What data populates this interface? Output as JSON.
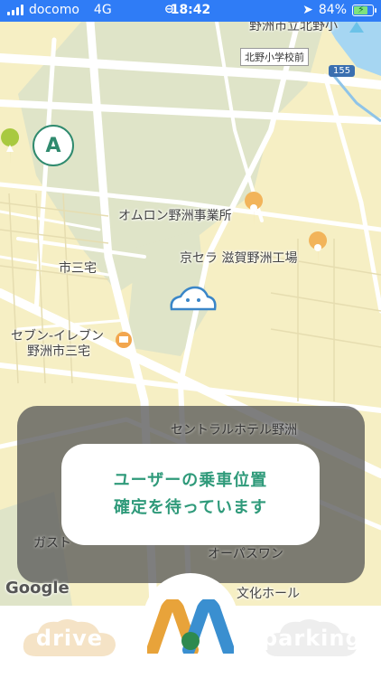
{
  "status": {
    "carrier": "docomo",
    "network": "4G",
    "time": "18:42",
    "battery": "84%"
  },
  "map": {
    "labels": {
      "school_top": "野洲市立北野小",
      "bus_stop": "北野小学校前",
      "route_number": "155",
      "omron": "オムロン野洲事業所",
      "kyocera": "京セラ 滋賀野洲工場",
      "ichimiyake": "市三宅",
      "seven_line1": "セブン-イレブン",
      "seven_line2": "野洲市三宅",
      "hotel": "セントラルホテル野洲",
      "gusto": "ガスト",
      "opaswan": "オーパスワン",
      "culture_hall": "文化ホール",
      "google": "Google"
    }
  },
  "overlay": {
    "line1": "ユーザーの乗車位置",
    "line2": "確定を待っています"
  },
  "nav": {
    "drive": "drive",
    "parking": "parking"
  },
  "colors": {
    "status_bar": "#2f7cf6",
    "accent_green": "#2f9a7a",
    "drive_cloud": "#f5e3c6",
    "parking_cloud": "#eeeeee"
  }
}
